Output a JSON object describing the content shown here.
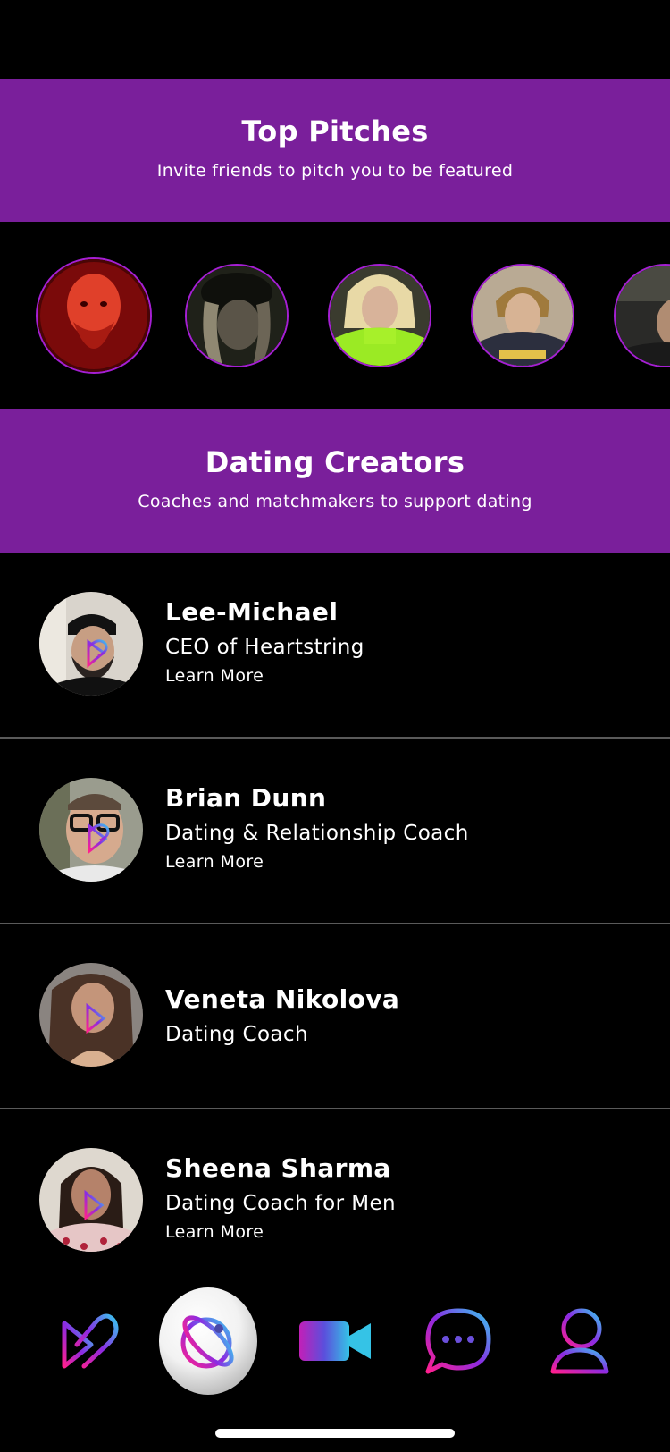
{
  "top_pitches": {
    "title": "Top Pitches",
    "subtitle": "Invite friends to pitch you to be featured",
    "avatars": [
      "pitch-avatar-1",
      "pitch-avatar-2",
      "pitch-avatar-3",
      "pitch-avatar-4",
      "pitch-avatar-5"
    ]
  },
  "dating_creators": {
    "title": "Dating Creators",
    "subtitle": "Coaches and matchmakers to support dating",
    "items": [
      {
        "name": "Lee-Michael",
        "role": "CEO of Heartstring",
        "link": "Learn More"
      },
      {
        "name": "Brian Dunn",
        "role": "Dating & Relationship Coach",
        "link": "Learn More"
      },
      {
        "name": "Veneta Nikolova",
        "role": "Dating Coach",
        "link": ""
      },
      {
        "name": "Sheena Sharma",
        "role": "Dating Coach for Men",
        "link": "Learn More"
      }
    ]
  },
  "tab_bar": {
    "tabs": [
      {
        "icon": "heart-logo-icon",
        "active": false
      },
      {
        "icon": "planet-orbit-icon",
        "active": true
      },
      {
        "icon": "video-camera-icon",
        "active": false
      },
      {
        "icon": "chat-bubble-icon",
        "active": false
      },
      {
        "icon": "profile-icon",
        "active": false
      }
    ]
  },
  "colors": {
    "background": "#000000",
    "banner": "#7a1f9b",
    "avatar_ring": "#a51fd3",
    "divider": "#5a5a5a",
    "gradient_start": "#ff1f8f",
    "gradient_mid": "#8a2be2",
    "gradient_end": "#38c8f0"
  }
}
